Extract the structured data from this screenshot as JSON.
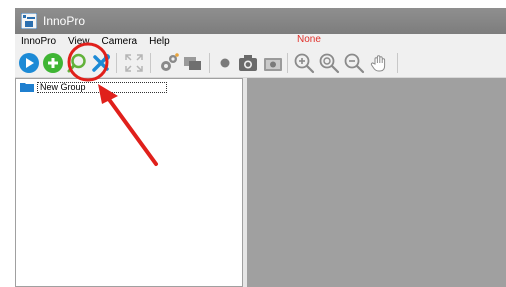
{
  "window": {
    "title": "InnoPro"
  },
  "menu": {
    "items": [
      "InnoPro",
      "View",
      "Camera",
      "Help"
    ],
    "status_text": "None"
  },
  "toolbar": {
    "buttons": [
      "play-icon",
      "add-icon",
      "search-icon",
      "tools-icon",
      "expand-arrows-icon",
      "settings-gears-icon",
      "layers-icon",
      "record-dot-icon",
      "camera-icon",
      "camera-alt-icon",
      "zoom-in-icon",
      "zoom-fit-icon",
      "zoom-out-icon",
      "hand-pan-icon"
    ]
  },
  "tree": {
    "items": [
      {
        "label": "New Group"
      }
    ]
  },
  "colors": {
    "title_bar": "#858585",
    "status_text": "#e0302a",
    "annotation": "#e0201b",
    "play": "#1c8ad6",
    "add": "#3fb534",
    "view_area": "#a0a0a0"
  }
}
